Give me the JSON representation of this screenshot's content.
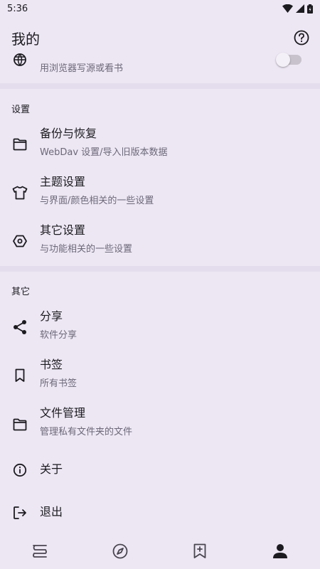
{
  "status_bar": {
    "time": "5:36"
  },
  "header": {
    "title": "我的"
  },
  "web_service": {
    "subtitle": "用浏览器写源或看书",
    "toggle_on": false
  },
  "settings_section": {
    "header": "设置",
    "items": [
      {
        "title": "备份与恢复",
        "subtitle": "WebDav 设置/导入旧版本数据",
        "icon": "folder-icon"
      },
      {
        "title": "主题设置",
        "subtitle": "与界面/颜色相关的一些设置",
        "icon": "tshirt-icon"
      },
      {
        "title": "其它设置",
        "subtitle": "与功能相关的一些设置",
        "icon": "settings-hexagon-icon"
      }
    ]
  },
  "other_section": {
    "header": "其它",
    "items": [
      {
        "title": "分享",
        "subtitle": "软件分享",
        "icon": "share-icon"
      },
      {
        "title": "书签",
        "subtitle": "所有书签",
        "icon": "bookmark-icon"
      },
      {
        "title": "文件管理",
        "subtitle": "管理私有文件夹的文件",
        "icon": "folder-icon"
      },
      {
        "title": "关于",
        "icon": "info-icon"
      },
      {
        "title": "退出",
        "icon": "exit-icon"
      }
    ]
  },
  "bottom_nav": {
    "items": [
      {
        "icon": "bookshelf-icon",
        "selected": false
      },
      {
        "icon": "compass-icon",
        "selected": false
      },
      {
        "icon": "rss-bookmark-icon",
        "selected": false
      },
      {
        "icon": "person-icon",
        "selected": true
      }
    ]
  },
  "colors": {
    "background": "#ede7f4",
    "divider": "#e4dded",
    "text": "#1c1b1f",
    "subtext": "#6d6878"
  }
}
